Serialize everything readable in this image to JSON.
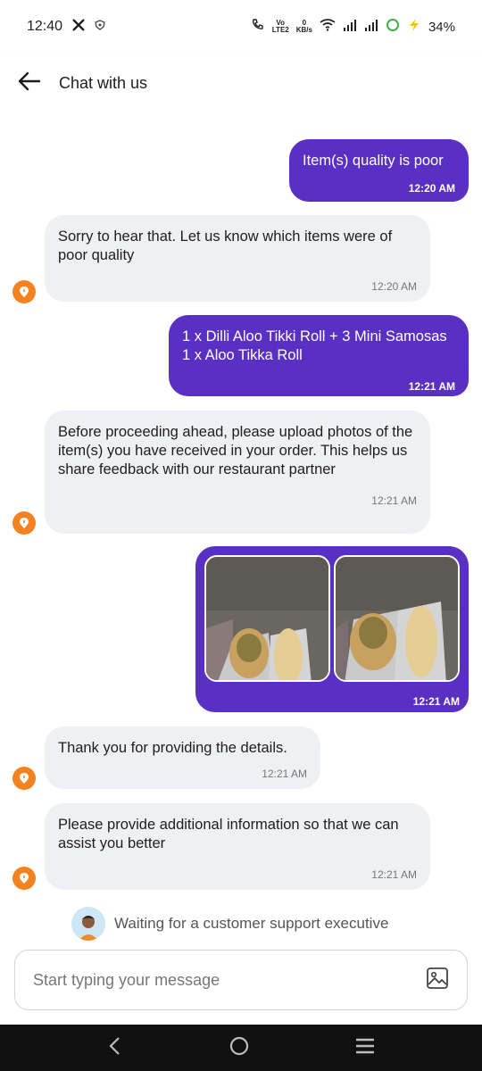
{
  "status_bar": {
    "time": "12:40",
    "x_icon": "x-logo-icon",
    "volte": "Vo",
    "lte": "LTE2",
    "speed_value": "0",
    "speed_unit": "KB/s",
    "battery": "34%"
  },
  "header": {
    "title": "Chat with us",
    "back_icon": "back-arrow-icon"
  },
  "messages": [
    {
      "direction": "out",
      "text": "Item(s) quality is poor",
      "time": "12:20 AM"
    },
    {
      "direction": "in",
      "text": "Sorry to hear that. Let us know which items were of poor quality",
      "time": "12:20 AM"
    },
    {
      "direction": "out",
      "lines": [
        "1 x Dilli Aloo Tikki Roll + 3 Mini Samosas",
        "1 x Aloo Tikka Roll"
      ],
      "time": "12:21 AM"
    },
    {
      "direction": "in",
      "text": "Before proceeding ahead, please upload photos of the item(s) you have received in your order. This helps us share feedback with our restaurant partner",
      "time": "12:21 AM"
    },
    {
      "direction": "out",
      "type": "images",
      "time": "12:21 AM"
    },
    {
      "direction": "in",
      "text": "Thank you for providing the details.",
      "time": "12:21 AM"
    },
    {
      "direction": "in",
      "text": "Please provide additional information so that we can assist you better",
      "time": "12:21 AM"
    }
  ],
  "waiting_text": "Waiting for a customer support executive",
  "composer": {
    "placeholder": "Start typing your message",
    "attach_icon": "image-attach-icon"
  },
  "colors": {
    "outgoing_bubble": "#5a2fc4",
    "incoming_bubble": "#eff0f4",
    "bot_avatar": "#f58220"
  }
}
